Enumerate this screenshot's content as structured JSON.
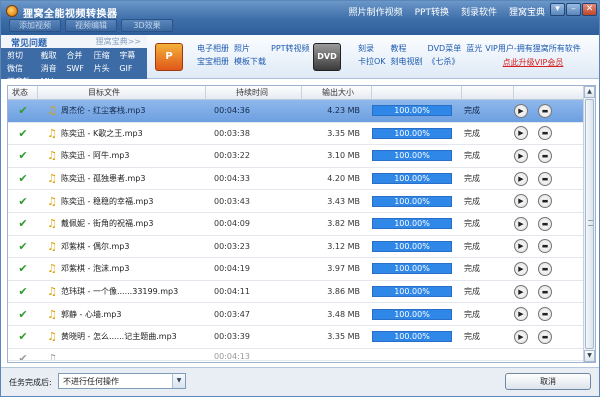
{
  "window": {
    "title": "狸窝全能视频转换器",
    "top_menu": [
      "照片制作视频",
      "PPT转换",
      "刻录软件",
      "狸窝宝典"
    ],
    "tool_tabs": [
      "添加视频",
      "视频编辑",
      "3D效果"
    ]
  },
  "banner": {
    "faq_title": "常见问题",
    "faq_more": "狸窝宝典>>",
    "faq_links": [
      "剪切",
      "截取",
      "合并",
      "压缩",
      "字幕",
      "微信",
      "消音",
      "SWF",
      "片头",
      "GIF",
      "双音轨",
      "MV"
    ],
    "promo1_icon": "P",
    "promo1_links": [
      "电子相册",
      "照片",
      "PPT转视频",
      "宝宝相册",
      "模板下载"
    ],
    "promo2_icon": "DVD",
    "promo2_links": [
      "刻录",
      "教程",
      "DVD菜单",
      "蓝光",
      "卡拉OK",
      "刻电视剧",
      "《七杀》"
    ],
    "vip_text": "VIP用户-拥有狸窝所有软件",
    "vip_link": "点此升级VIP会员"
  },
  "table": {
    "headers": [
      "状态",
      "目标文件",
      "持续时间",
      "输出大小",
      "",
      "",
      ""
    ],
    "rows": [
      {
        "file": "周杰伦 - 红尘客栈.mp3",
        "duration": "00:04:36",
        "size": "4.23 MB",
        "progress": "100.00%",
        "state": "完成"
      },
      {
        "file": "陈奕迅 - K歌之王.mp3",
        "duration": "00:03:38",
        "size": "3.35 MB",
        "progress": "100.00%",
        "state": "完成"
      },
      {
        "file": "陈奕迅 - 阿牛.mp3",
        "duration": "00:03:22",
        "size": "3.10 MB",
        "progress": "100.00%",
        "state": "完成"
      },
      {
        "file": "陈奕迅 - 孤独患者.mp3",
        "duration": "00:04:33",
        "size": "4.20 MB",
        "progress": "100.00%",
        "state": "完成"
      },
      {
        "file": "陈奕迅 - 稳稳的幸福.mp3",
        "duration": "00:03:43",
        "size": "3.43 MB",
        "progress": "100.00%",
        "state": "完成"
      },
      {
        "file": "戴佩妮 - 街角的祝福.mp3",
        "duration": "00:04:09",
        "size": "3.82 MB",
        "progress": "100.00%",
        "state": "完成"
      },
      {
        "file": "邓紫棋 - 偶尔.mp3",
        "duration": "00:03:23",
        "size": "3.12 MB",
        "progress": "100.00%",
        "state": "完成"
      },
      {
        "file": "邓紫棋 - 泡沫.mp3",
        "duration": "00:04:19",
        "size": "3.97 MB",
        "progress": "100.00%",
        "state": "完成"
      },
      {
        "file": "范玮琪 - 一个像......33199.mp3",
        "duration": "00:04:11",
        "size": "3.86 MB",
        "progress": "100.00%",
        "state": "完成"
      },
      {
        "file": "郭静 - 心墙.mp3",
        "duration": "00:03:47",
        "size": "3.48 MB",
        "progress": "100.00%",
        "state": "完成"
      },
      {
        "file": "黄晓明 - 怎么......记主题曲.mp3",
        "duration": "00:03:39",
        "size": "3.35 MB",
        "progress": "100.00%",
        "state": "完成"
      }
    ],
    "partial_row_duration": "00:04:13"
  },
  "bottom": {
    "after_label": "任务完成后:",
    "after_value": "不进行任何操作",
    "cancel_label": "取消"
  },
  "colors": {
    "titlebar": "#3d6ea8",
    "selected_row": "#7aa7e4",
    "progress": "#2f87e8",
    "vip_link": "#d62020"
  }
}
